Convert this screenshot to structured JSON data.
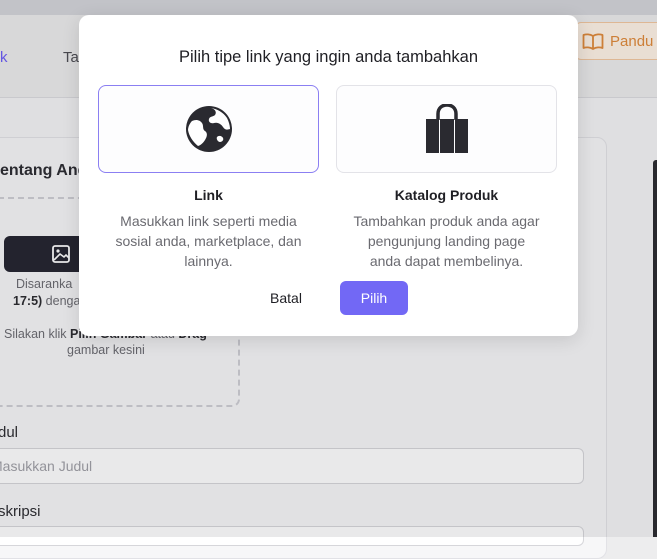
{
  "nav": {
    "tab_partial_1": "k",
    "tab_partial_2": "Ta",
    "guide_label": "Pandu"
  },
  "card": {
    "title_partial": "entang And",
    "dropzone": {
      "hint_line1": "Disaranka",
      "hint_line2_bold": "17:5)",
      "hint_line2": " denga",
      "instruction_prefix": "Silakan klik ",
      "instruction_bold": "Pilih Gambar",
      "instruction_mid": " atau ",
      "instruction_bold2": "Drag",
      "instruction_line2": "gambar kesini"
    },
    "title_field_label": "dul",
    "title_field_placeholder": "Masukkan Judul",
    "desc_field_label": "skripsi"
  },
  "modal": {
    "title": "Pilih tipe link yang ingin anda tambahkan",
    "options": [
      {
        "icon": "globe-icon",
        "name": "Link",
        "desc_line1": "Masukkan link seperti media",
        "desc_line2": "sosial anda, marketplace, dan",
        "desc_line3": "lainnya."
      },
      {
        "icon": "shopping-bag-icon",
        "name": "Katalog Produk",
        "desc_line1": "Tambahkan produk anda agar",
        "desc_line2": "pengunjung landing page",
        "desc_line3": "anda dapat membelinya."
      }
    ],
    "cancel_label": "Batal",
    "confirm_label": "Pilih"
  },
  "colors": {
    "accent": "#7268f5",
    "selected_border": "#8b7ff2",
    "guide_orange": "#e08a39",
    "dark_button": "#23232e"
  }
}
